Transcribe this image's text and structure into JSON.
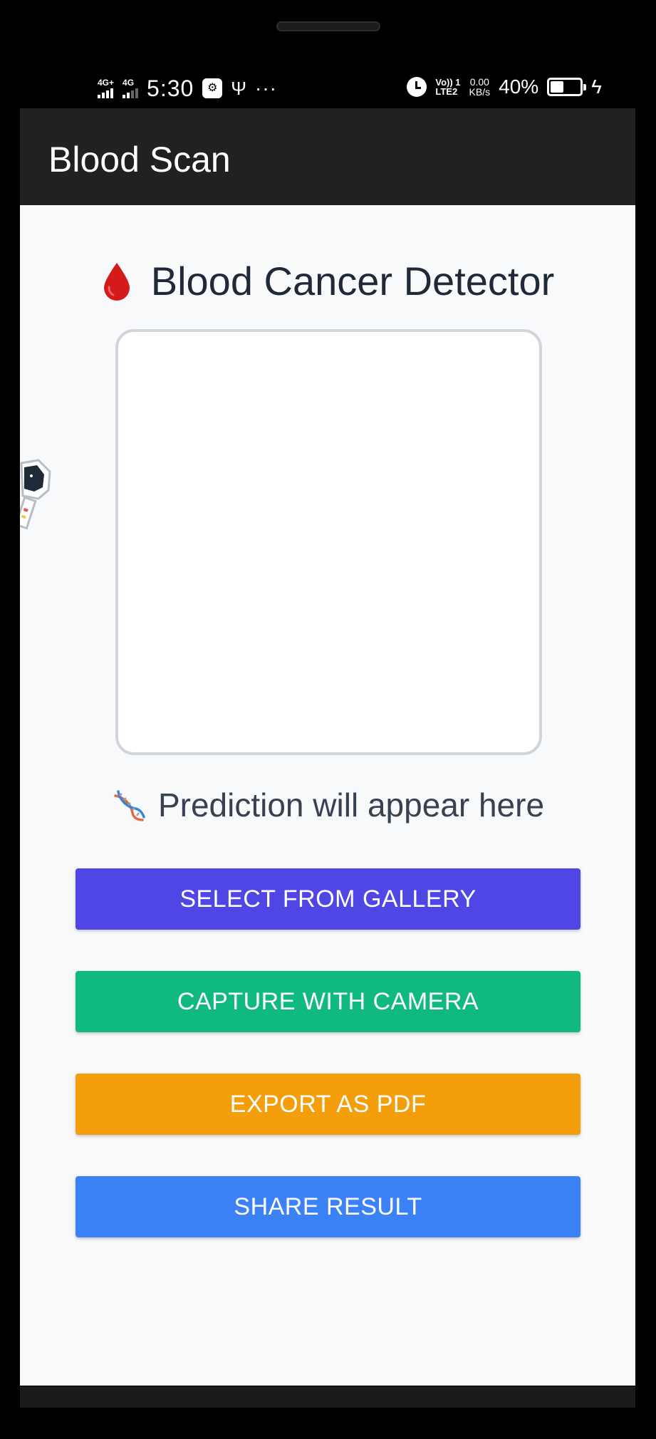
{
  "status_bar": {
    "network1": "4G+",
    "network2": "4G",
    "time": "5:30",
    "volte_top": "Vo)) 1",
    "volte_bottom": "LTE2",
    "speed_top": "0.00",
    "speed_bottom": "KB/s",
    "battery_percent": "40%",
    "battery_level": 0.4
  },
  "app_bar": {
    "title": "Blood Scan"
  },
  "main": {
    "title": "Blood Cancer Detector",
    "prediction_text": "Prediction will appear here"
  },
  "buttons": {
    "gallery": "SELECT FROM GALLERY",
    "camera": "CAPTURE WITH CAMERA",
    "pdf": "EXPORT AS PDF",
    "share": "SHARE RESULT"
  },
  "colors": {
    "gallery": "#4f46e5",
    "camera": "#10b981",
    "pdf": "#f59e0b",
    "share": "#3b82f6",
    "app_bar": "#212121"
  },
  "icons": {
    "header": "blood-drop-icon",
    "prediction": "dna-icon"
  }
}
